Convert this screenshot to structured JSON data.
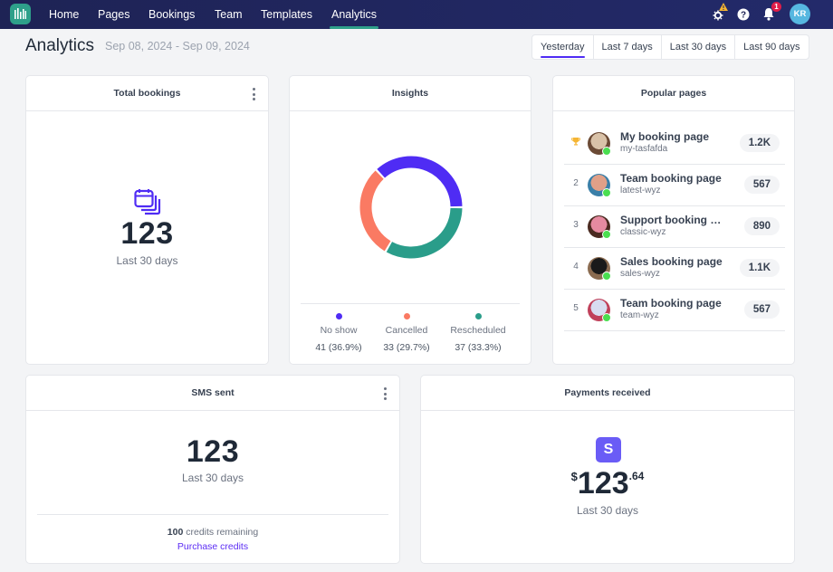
{
  "nav": {
    "logo": "app-logo",
    "items": [
      {
        "label": "Home",
        "active": false
      },
      {
        "label": "Pages",
        "active": false
      },
      {
        "label": "Bookings",
        "active": false
      },
      {
        "label": "Team",
        "active": false
      },
      {
        "label": "Templates",
        "active": false
      },
      {
        "label": "Analytics",
        "active": true
      }
    ],
    "notifications_count": "1",
    "user_initials": "KR",
    "accent": "#2ea08a"
  },
  "header": {
    "title": "Analytics",
    "date_range": "Sep 08, 2024 - Sep 09, 2024",
    "range_tabs": [
      {
        "label": "Yesterday",
        "active": true
      },
      {
        "label": "Last 7 days",
        "active": false
      },
      {
        "label": "Last 30 days",
        "active": false
      },
      {
        "label": "Last 90 days",
        "active": false
      }
    ]
  },
  "total_bookings": {
    "title": "Total bookings",
    "value": "123",
    "period": "Last 30 days",
    "icon": "calendar-stack-icon"
  },
  "insights": {
    "title": "Insights",
    "chart_data": {
      "type": "pie",
      "variant": "donut",
      "categories": [
        "No show",
        "Cancelled",
        "Rescheduled"
      ],
      "values": [
        41,
        33,
        37
      ],
      "percents": [
        36.9,
        29.7,
        33.3
      ],
      "colors": [
        "#4f2cf4",
        "#fa7a63",
        "#2a9d8a"
      ]
    },
    "legend": [
      {
        "label": "No show",
        "value": "41 (36.9%)",
        "color": "#4f2cf4"
      },
      {
        "label": "Cancelled",
        "value": "33 (29.7%)",
        "color": "#fa7a63"
      },
      {
        "label": "Rescheduled",
        "value": "37 (33.3%)",
        "color": "#2a9d8a"
      }
    ]
  },
  "popular_pages": {
    "title": "Popular pages",
    "items": [
      {
        "rank": "trophy",
        "name": "My booking page",
        "slug": "my-tasfafda",
        "count": "1.2K"
      },
      {
        "rank": "2",
        "name": "Team booking page",
        "slug": "latest-wyz",
        "count": "567"
      },
      {
        "rank": "3",
        "name": "Support booking page",
        "slug": "classic-wyz",
        "count": "890"
      },
      {
        "rank": "4",
        "name": "Sales booking page",
        "slug": "sales-wyz",
        "count": "1.1K"
      },
      {
        "rank": "5",
        "name": "Team booking page",
        "slug": "team-wyz",
        "count": "567"
      }
    ]
  },
  "sms_sent": {
    "title": "SMS sent",
    "value": "123",
    "period": "Last 30 days",
    "credits_count": "100",
    "credits_text": "credits remaining",
    "purchase_label": "Purchase credits"
  },
  "payments": {
    "title": "Payments received",
    "currency": "$",
    "amount": "123",
    "cents": ".64",
    "period": "Last 30 days",
    "provider_letter": "S"
  }
}
